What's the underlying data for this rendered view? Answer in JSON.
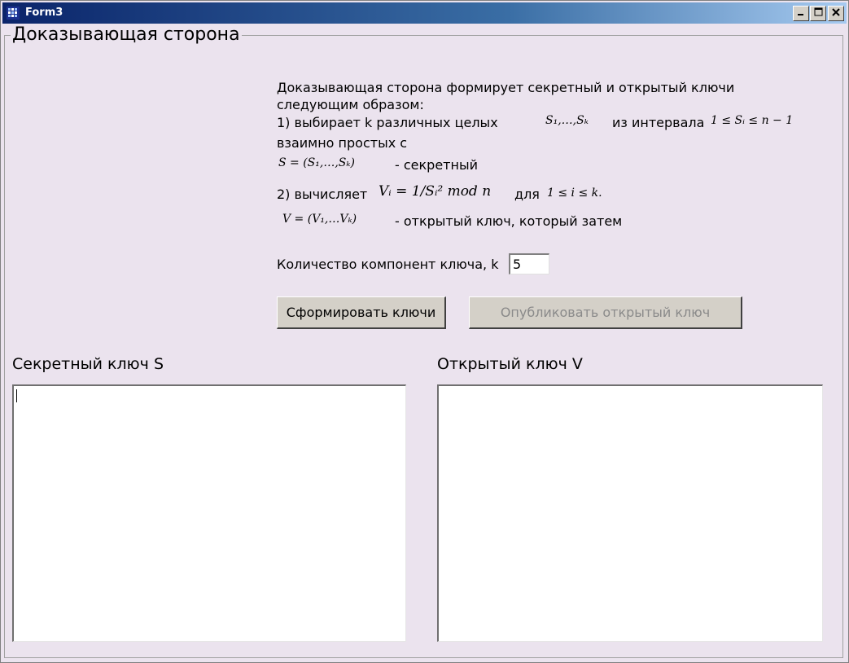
{
  "window": {
    "title": "Form3"
  },
  "group": {
    "title": "Доказывающая сторона"
  },
  "description": {
    "line1": "Доказывающая сторона формирует секретный и открытый ключи",
    "line2": "следующим образом:",
    "line3a": "1) выбирает k различных целых",
    "formula_s_list": "S₁,…,Sₖ",
    "line3b": "из интервала",
    "formula_interval": "1 ≤ Sᵢ ≤ n − 1",
    "line4": "взаимно простых с",
    "formula_secret": "S = (S₁,…,Sₖ)",
    "line5": "- секретный",
    "line6a": "2) вычисляет",
    "formula_v": "Vᵢ = 1/Sᵢ² mod n",
    "line6b": "для",
    "formula_range": "1 ≤ i ≤ k.",
    "formula_public": "V = (V₁,…Vₖ)",
    "line7": "- открытый ключ, который затем"
  },
  "k_field": {
    "label": "Количество компонент ключа, k",
    "value": "5"
  },
  "buttons": {
    "generate": "Сформировать ключи",
    "publish": "Опубликовать открытый ключ"
  },
  "secret_key": {
    "label": "Секретный ключ S",
    "value": ""
  },
  "public_key": {
    "label": "Открытый ключ V",
    "value": ""
  }
}
